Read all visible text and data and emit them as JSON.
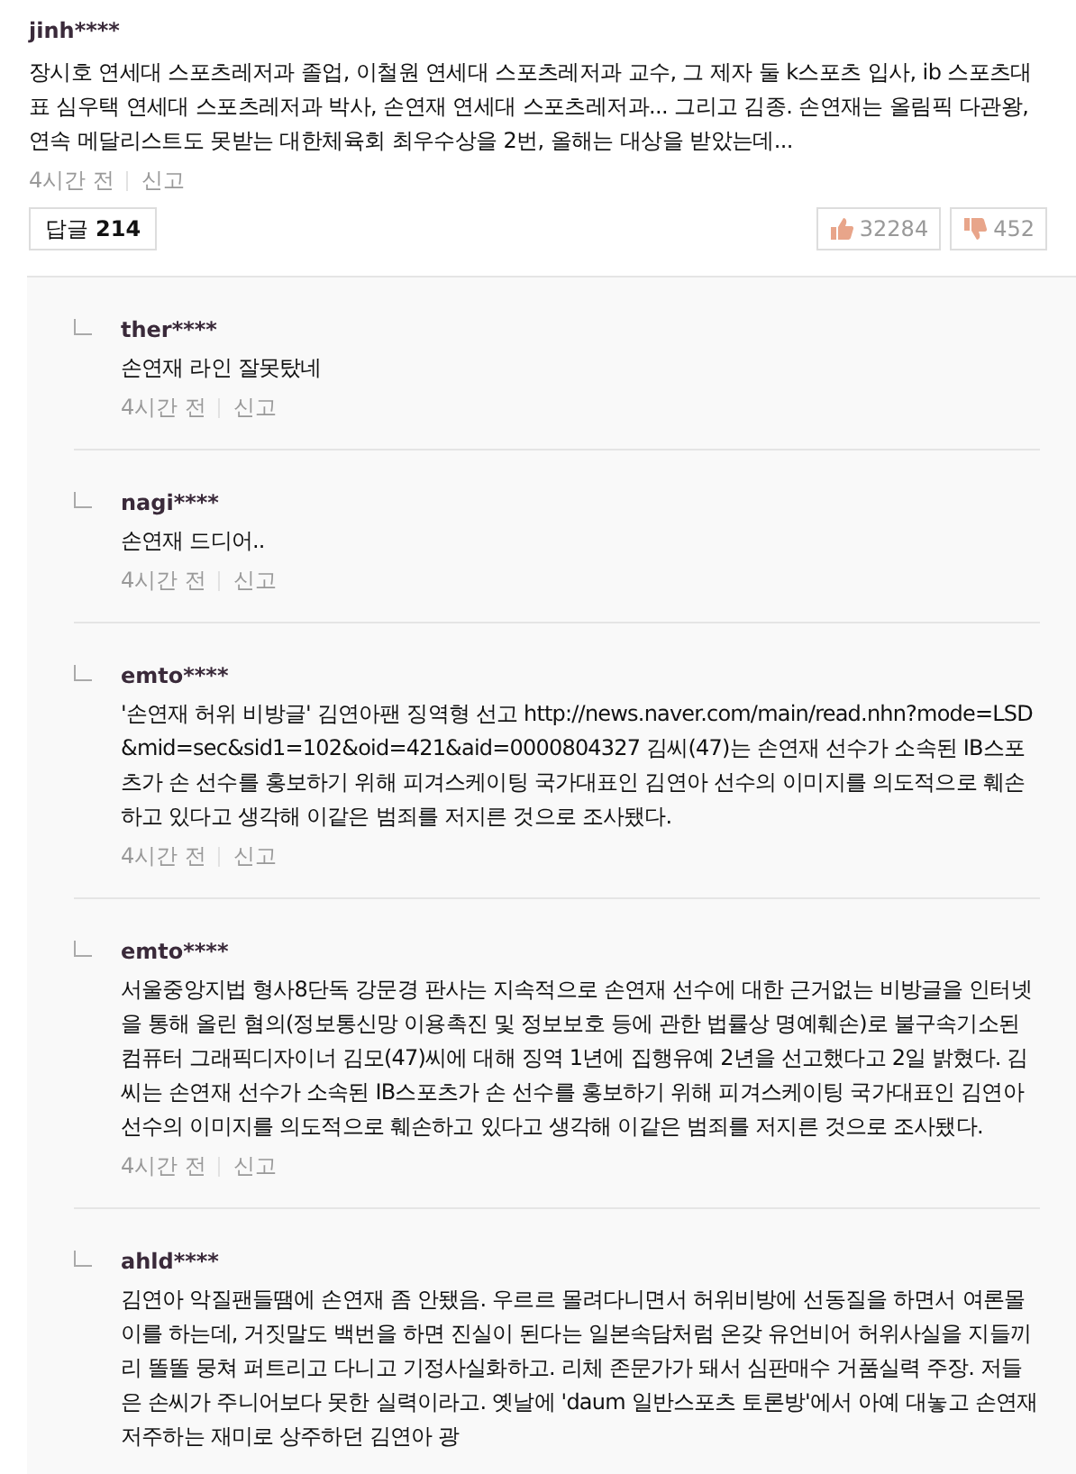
{
  "comment": {
    "author": "jinh****",
    "text": "장시호 연세대 스포츠레저과 졸업, 이철원 연세대 스포츠레저과 교수, 그 제자 둘 k스포츠 입사, ib 스포츠대표 심우택 연세대 스포츠레저과 박사, 손연재 연세대 스포츠레저과... 그리고 김종. 손연재는 올림픽 다관왕, 연속 메달리스트도 못받는 대한체육회 최우수상을 2번, 올해는 대상을 받았는데...",
    "time": "4시간 전",
    "report": "신고",
    "reply_button": {
      "label": "답글",
      "count": "214"
    },
    "likes": "32284",
    "dislikes": "452"
  },
  "replies": [
    {
      "author": "ther****",
      "text": "손연재 라인 잘못탔네",
      "time": "4시간 전",
      "report": "신고"
    },
    {
      "author": "nagi****",
      "text": "손연재 드디어..",
      "time": "4시간 전",
      "report": "신고"
    },
    {
      "author": "emto****",
      "text": "'손연재 허위 비방글' 김연아팬 징역형 선고 http://news.naver.com/main/read.nhn?mode=LSD&mid=sec&sid1=102&oid=421&aid=0000804327 김씨(47)는 손연재 선수가 소속된 IB스포츠가 손 선수를 홍보하기 위해 피겨스케이팅 국가대표인 김연아 선수의 이미지를 의도적으로 훼손하고 있다고 생각해 이같은 범죄를 저지른 것으로 조사됐다.",
      "time": "4시간 전",
      "report": "신고"
    },
    {
      "author": "emto****",
      "text": "서울중앙지법 형사8단독 강문경 판사는 지속적으로 손연재 선수에 대한 근거없는 비방글을 인터넷을 통해 올린 혐의(정보통신망 이용촉진 및 정보보호 등에 관한 법률상 명예훼손)로 불구속기소된 컴퓨터 그래픽디자이너 김모(47)씨에 대해 징역 1년에 집행유예 2년을 선고했다고 2일 밝혔다. 김씨는 손연재 선수가 소속된 IB스포츠가 손 선수를 홍보하기 위해 피겨스케이팅 국가대표인 김연아 선수의 이미지를 의도적으로 훼손하고 있다고 생각해 이같은 범죄를 저지른 것으로 조사됐다.",
      "time": "4시간 전",
      "report": "신고"
    },
    {
      "author": "ahld****",
      "text": "김연아 악질팬들땜에 손연재 좀 안됐음. 우르르 몰려다니면서 허위비방에 선동질을 하면서 여론몰이를 하는데, 거짓말도 백번을 하면 진실이 된다는 일본속담처럼 온갖 유언비어 허위사실을 지들끼리 똘똘 뭉쳐 퍼트리고 다니고 기정사실화하고. 리체 존문가가 돼서 심판매수 거품실력 주장. 저들은 손씨가 주니어보다 못한 실력이라고. 옛날에 'daum 일반스포츠 토론방'에서 아예 대놓고 손연재 저주하는 재미로 상주하던 김연아 광"
    }
  ]
}
